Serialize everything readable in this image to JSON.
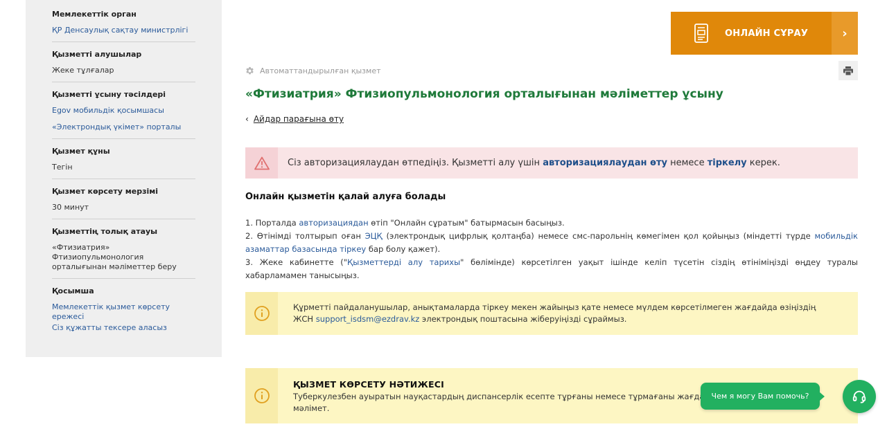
{
  "sidebar": {
    "sections": [
      {
        "title": "Мемлекеттік орган",
        "links": [
          "ҚР Денсаулық сақтау министрлігі"
        ]
      },
      {
        "title": "Қызметті алушылар",
        "value": "Жеке тұлғалар"
      },
      {
        "title": "Қызметті ұсыну тәсілдері",
        "links": [
          "Egov мобильдік қосымшасы",
          "«Электрондық үкімет» порталы"
        ]
      },
      {
        "title": "Қызмет құны",
        "value": "Тегін"
      },
      {
        "title": "Қызмет көрсету мерзімі",
        "value": "30 минут"
      },
      {
        "title": "Қызметтің толық атауы",
        "value": "«Фтизиатрия» Фтизиопульмонология орталығынан мәлiметтер беру"
      },
      {
        "title": "Қосымша",
        "links": [
          "Мемлекеттік қызмет көрсету ережесі",
          "Сіз құжатты тексере аласыз"
        ]
      }
    ]
  },
  "main": {
    "online_button": {
      "label": "ОНЛАЙН СҰРАУ",
      "arrow": "›"
    },
    "auto_label": "Автоматтандырылған қызмет",
    "title": "«Фтизиатрия» Фтизиопульмонология орталығынан мәліметтер ұсыну",
    "back_link": {
      "chevron": "‹",
      "label": "Айдар парағына өту"
    },
    "auth_alert": {
      "text_before": "Сіз авторизациялаудан өтпедіңіз. Қызметті алу үшін ",
      "auth_link": "авторизациялаудан өту",
      "text_middle": " немесе ",
      "register_link": "тіркелу",
      "text_after": " керек."
    },
    "how_title": "Онлайн қызметін қалай алуға болады",
    "steps": {
      "s1_prefix": "1. Порталда ",
      "s1_link": "авторизациядан",
      "s1_suffix": " өтіп \"Онлайн сұратым\" батырмасын басыңыз.",
      "s2_prefix": "2. Өтінімді толтырып оған ",
      "s2_link1": "ЭЦҚ",
      "s2_middle": " (электрондық цифрлық қолтаңба) немесе смс-парольнің көмегімен қол қойыңыз (міндетті түрде ",
      "s2_link2": "мобильдік азаматтар базасында тіркеу",
      "s2_suffix": " бар болу қажет).",
      "s3_prefix": "3. Жеке кабинетте (\"",
      "s3_link": "Қызметтерді алу тарихы",
      "s3_suffix": "\" бөлімінде) көрсетілген уақыт ішінде келіп түсетін сіздің өтініміңізді өңдеу туралы хабарламамен танысыңыз."
    },
    "note": {
      "line1": "Құрметті пайдаланушылар, анықтамаларда тіркеу мекен жайыңыз қате немесе мүлдем көрсетілмеген жағдайда өзіңіздің",
      "line2_prefix": "ЖСН ",
      "email": "support_isdsm@ezdrav.kz",
      "line2_suffix": " электрондық поштасына жіберуіңізді сұраймыз."
    },
    "result": {
      "title": "ҚЫЗМЕТ КӨРСЕТУ НӘТИЖЕСІ",
      "line1": "Туберкулезбен ауыратын науқастардың диспансерлік есепте тұрғаны немесе тұрмағаны жағдайы",
      "line2": "мәлімет."
    }
  },
  "chat": {
    "bubble_text": "Чем я могу Вам помочь?"
  },
  "colors": {
    "accent_orange": "#e0880a",
    "title_green": "#1f7a3a",
    "chat_green": "#22b060",
    "link_blue": "#2a5a9a"
  }
}
